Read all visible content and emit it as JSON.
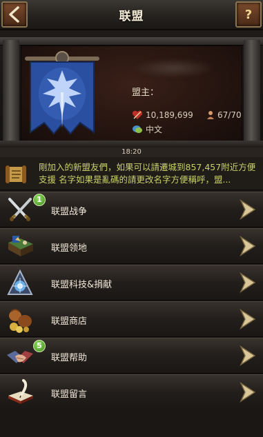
{
  "header": {
    "title": "联盟",
    "back_icon": "back-arrow-icon",
    "help_label": "?"
  },
  "alliance": {
    "lord_label": "盟主：",
    "power": "10,189,699",
    "members": "67/70",
    "language": "中文",
    "banner_color": "#2a4fa0"
  },
  "chat": {
    "time": "18:20",
    "message": "剛加入的新盟友們，如果可以請遷城到857,457附近方便支援 名字如果是亂碼的請更改名字方便稱呼，盟..."
  },
  "menu": {
    "items": [
      {
        "label": "联盟战争",
        "icon": "crossed-swords-icon",
        "badge": "1"
      },
      {
        "label": "联盟领地",
        "icon": "territory-map-icon",
        "badge": ""
      },
      {
        "label": "联盟科技&捐献",
        "icon": "tech-crystal-icon",
        "badge": ""
      },
      {
        "label": "联盟商店",
        "icon": "shop-goods-icon",
        "badge": ""
      },
      {
        "label": "联盟帮助",
        "icon": "handshake-icon",
        "badge": "5"
      },
      {
        "label": "联盟留言",
        "icon": "quill-book-icon",
        "badge": ""
      }
    ]
  }
}
